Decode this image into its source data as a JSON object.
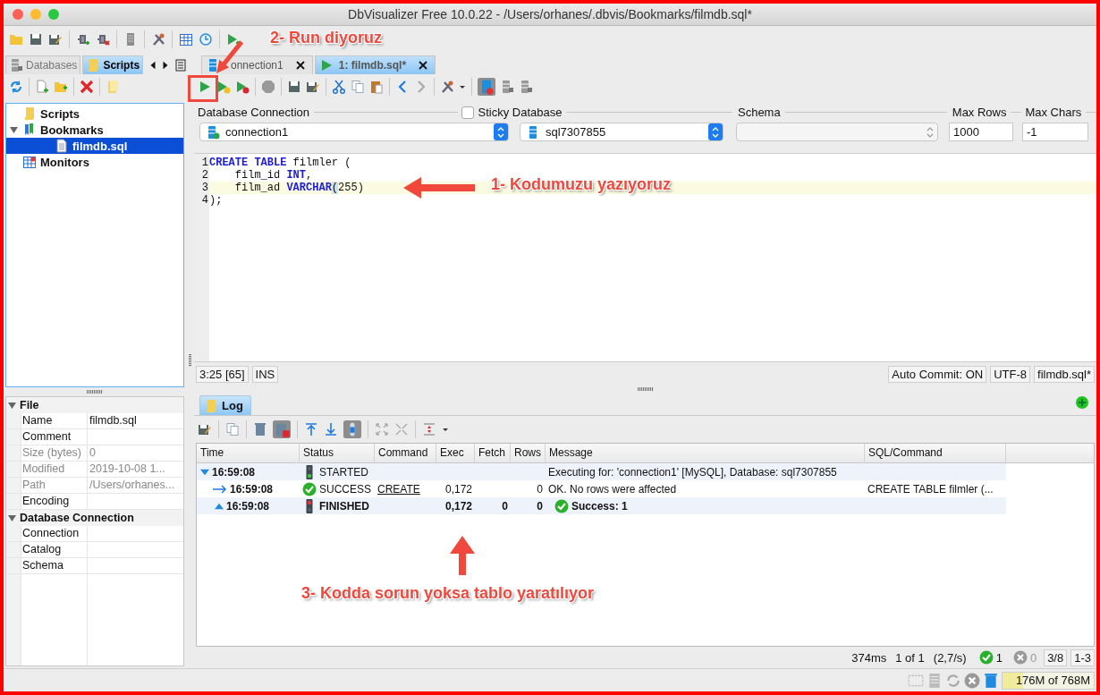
{
  "window": {
    "title": "DbVisualizer Free 10.0.22 - /Users/orhanes/.dbvis/Bookmarks/filmdb.sql*"
  },
  "sidebar": {
    "tabs": [
      {
        "label": "Databases",
        "selected": false
      },
      {
        "label": "Scripts",
        "selected": true
      }
    ],
    "tree": [
      {
        "label": "Scripts",
        "kind": "scripts",
        "selected": false
      },
      {
        "label": "Bookmarks",
        "kind": "bookmarks",
        "selected": false,
        "expanded": true,
        "children": [
          {
            "label": "filmdb.sql",
            "kind": "file",
            "selected": true
          }
        ]
      },
      {
        "label": "Monitors",
        "kind": "monitors",
        "selected": false
      }
    ]
  },
  "properties": [
    {
      "group": "File",
      "expanded": true,
      "rows": [
        {
          "name": "Name",
          "value": "filmdb.sql",
          "disabled": false
        },
        {
          "name": "Comment",
          "disabled": false
        },
        {
          "name": "Size (bytes)",
          "value": "0",
          "disabled": true
        },
        {
          "name": "Modified",
          "value": "2019-10-08 1...",
          "disabled": true
        },
        {
          "name": "Path",
          "value": "/Users/orhanes...",
          "disabled": true
        },
        {
          "name": "Encoding",
          "disabled": false
        }
      ]
    },
    {
      "group": "Database Connection",
      "expanded": true,
      "rows": [
        {
          "name": "Connection",
          "disabled": false
        },
        {
          "name": "Catalog",
          "disabled": false
        },
        {
          "name": "Schema",
          "disabled": false
        }
      ]
    }
  ],
  "editor_tabs": [
    {
      "label": "onnection1",
      "kind": "connection",
      "selected": false
    },
    {
      "label": "1: filmdb.sql*",
      "kind": "script",
      "selected": true
    }
  ],
  "connection_bar": {
    "connection_label": "Database Connection",
    "connection": "connection1",
    "sticky_label": "Sticky Database",
    "sticky_checked": false,
    "database": "sql7307855",
    "schema_label": "Schema",
    "max_rows_label": "Max Rows",
    "max_rows": "1000",
    "max_chars_label": "Max Chars",
    "max_chars": "-1"
  },
  "editor": {
    "lines": [
      {
        "number": "1",
        "current": false,
        "tokens": [
          {
            "kind": "keyword",
            "text": "CREATE TABLE"
          },
          {
            "kind": "plain",
            "text": " filmler ("
          }
        ]
      },
      {
        "number": "2",
        "current": false,
        "tokens": [
          {
            "kind": "plain",
            "text": "    film_id "
          },
          {
            "kind": "keyword",
            "text": "INT"
          },
          {
            "kind": "plain",
            "text": ","
          }
        ]
      },
      {
        "number": "3",
        "current": true,
        "tokens": [
          {
            "kind": "plain",
            "text": "    film_ad "
          },
          {
            "kind": "keyword",
            "text": "VARCHAR"
          },
          {
            "kind": "match",
            "text": "("
          },
          {
            "kind": "plain",
            "text": "255)"
          }
        ]
      },
      {
        "number": "4",
        "current": false,
        "tokens": [
          {
            "kind": "plain",
            "text": ");"
          }
        ]
      }
    ]
  },
  "editor_status": {
    "position": "3:25 [65]",
    "mode": "INS",
    "auto_commit": "Auto Commit: ON",
    "encoding": "UTF-8",
    "file": "filmdb.sql*"
  },
  "log": {
    "tab": "Log",
    "columns": [
      "Time",
      "Status",
      "Command",
      "Exec",
      "Fetch",
      "Rows",
      "Message",
      "SQL/Command"
    ],
    "rows": [
      {
        "kind": "started",
        "time": "16:59:08",
        "status": "STARTED",
        "message": "Executing for: 'connection1' [MySQL], Database: sql7307855"
      },
      {
        "kind": "success",
        "time": "16:59:08",
        "status": "SUCCESS",
        "command": "CREATE",
        "exec": "0,172",
        "rows": "0",
        "message": "OK. No rows were affected",
        "sql": "CREATE TABLE filmler (..."
      },
      {
        "kind": "finished",
        "time": "16:59:08",
        "status": "FINISHED",
        "exec": "0,172",
        "fetch": "0",
        "rows": "0",
        "message": "Success: 1"
      }
    ],
    "status": {
      "duration": "374ms",
      "page": "1 of 1",
      "rate": "(2,7/s)",
      "success_count": "1",
      "error_count": "0",
      "position": "3/8",
      "range": "1-3"
    }
  },
  "memory": {
    "text": "176M of 768M",
    "level": 0.23
  },
  "annotations": [
    {
      "kind": "run",
      "text": "2- Run diyoruz"
    },
    {
      "kind": "code",
      "text": "1- Kodumuzu yazıyoruz"
    },
    {
      "kind": "result",
      "text": "3- Kodda sorun yoksa tablo yaratılıyor"
    }
  ]
}
